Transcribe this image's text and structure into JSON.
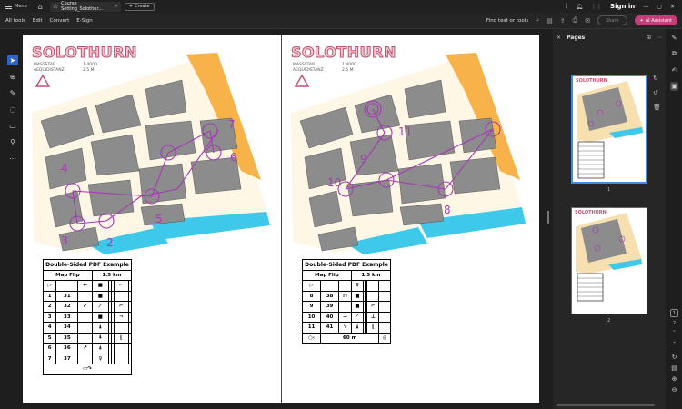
{
  "titlebar": {
    "menu_label": "Menu",
    "tab_title": "Course Setting_Solothur...",
    "create_label": "Create",
    "sign_in": "Sign in"
  },
  "toolbar": {
    "menu_items": [
      "All tools",
      "Edit",
      "Convert",
      "E-Sign"
    ],
    "find_label": "Find text or tools",
    "share_label": "Share",
    "ai_label": "AI Assistant"
  },
  "document": {
    "left_page": {
      "map_title": "SOLOTHURN",
      "scale_label_1": "MASSSTAB",
      "scale_label_2": "AEQUIDISTANZ",
      "scale_value_1": "1:4000",
      "scale_value_2": "2.5 M",
      "control_numbers": [
        "2",
        "3",
        "4",
        "5",
        "6",
        "7"
      ],
      "card_title": "Double-Sided PDF Example",
      "card_event": "Map Flip",
      "card_length": "1.5 km",
      "rows": [
        {
          "n": "1",
          "c": "31"
        },
        {
          "n": "2",
          "c": "32"
        },
        {
          "n": "3",
          "c": "33"
        },
        {
          "n": "4",
          "c": "34"
        },
        {
          "n": "5",
          "c": "35"
        },
        {
          "n": "6",
          "c": "36"
        },
        {
          "n": "7",
          "c": "37"
        }
      ]
    },
    "right_page": {
      "map_title": "SOLOTHURN",
      "scale_label_1": "MASSSTAB",
      "scale_label_2": "AEQUIDISTANZ",
      "scale_value_1": "1:4000",
      "scale_value_2": "2.5 M",
      "control_numbers": [
        "8",
        "9",
        "10",
        "11"
      ],
      "card_title": "Double-Sided PDF Example",
      "card_event": "Map Flip",
      "card_length": "1.5 km",
      "rows": [
        {
          "n": "8",
          "c": "38"
        },
        {
          "n": "9",
          "c": "39"
        },
        {
          "n": "10",
          "c": "40"
        },
        {
          "n": "11",
          "c": "41"
        }
      ],
      "finish_distance": "60 m"
    }
  },
  "pages_panel": {
    "title": "Pages",
    "page_numbers": [
      "1",
      "2"
    ]
  },
  "page_nav": {
    "current": "1",
    "total": "2"
  },
  "colors": {
    "accent": "#2f64c8",
    "ai_button": "#c93c7a",
    "course_purple": "#a53ab5",
    "water": "#3ec8ea",
    "building": "#8c8c8c",
    "open_land": "#f7b24a"
  }
}
